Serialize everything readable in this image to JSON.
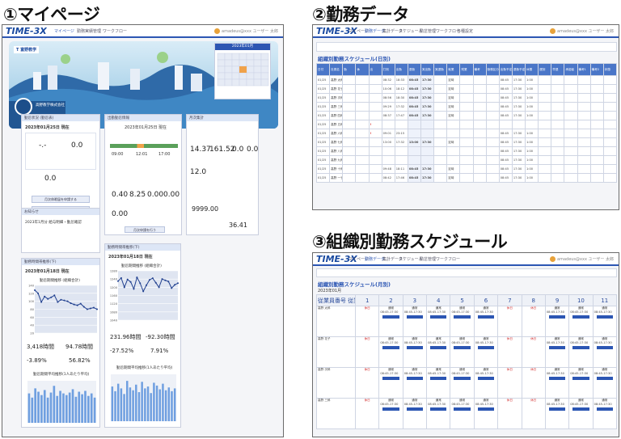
{
  "labels": {
    "panel1": "①マイページ",
    "panel2": "②勤務データ",
    "panel3": "③組織別勤務スケジュール"
  },
  "app": {
    "logo": "TIME-3X",
    "nav1": [
      "マイページ",
      "勤務実績管理",
      "ワークフロー"
    ],
    "nav2": [
      "マイページ",
      "勤務データ",
      "集計データ",
      "スケジュール",
      "勤怠管理",
      "ワークフロー",
      "各種設定",
      "従業員",
      "設定"
    ],
    "user": "amadeus@xxx ユーザー 太郎"
  },
  "mypage": {
    "banner_brand": "T 富野教学",
    "banner_greeting": "高野教学株式会社",
    "calendar_title": "2023年01月",
    "card_titles": [
      "勤怠状況 (勤怠表)",
      "出勤勤怠情報",
      "月次集計",
      "お知らせ",
      "勤務時間帯推移(下)",
      "勤務時間帯推移(下)"
    ],
    "clock_date": "2023年01月25日 現在",
    "work_times": [
      "09:00",
      "17:00",
      "12:01"
    ],
    "work_times_end": "17:00",
    "stats_top": [
      "14.37",
      "161.52",
      "0.0",
      "0.0"
    ],
    "stats_mid": [
      "12.0"
    ],
    "stats_detail": [
      "0.40",
      "8.25",
      "0.00",
      "0.00"
    ],
    "stats_zero": "0.00",
    "balance": [
      "9999.00",
      "36.41"
    ],
    "clock_buttons": [
      "月次休暇届を申請する",
      "月次休暇届を承認する"
    ],
    "detail_button": "月次申請を行う",
    "notice_title": "2023年1月分 給与明細・勤怠確認",
    "left_date": "2023年01月18日 現在",
    "right_date": "2023年01月18日 現在",
    "left_chart_title": "勤怠期間推移 (組織合計)",
    "right_chart_title": "勤怠期間推移 (組織合計)",
    "left_metrics": [
      "3,418時間",
      "94.78時間",
      "-3.89%",
      "56.82%"
    ],
    "right_metrics": [
      "231.96時間",
      "-92.30時間",
      "-27.52%",
      "7.91%"
    ],
    "left_bar_title": "勤怠期間平均推移(1人あたり平均)",
    "right_bar_title": "勤怠期間平均推移(1人あたり平均)"
  },
  "workdata": {
    "section_title": "組織別勤務スケジュール(日別)",
    "headers": [
      "日付",
      "社員名",
      "勤",
      "休",
      "出",
      "打刻",
      "出勤",
      "退勤",
      "実出勤",
      "実退勤",
      "就業",
      "残業",
      "備考",
      "勤務区分",
      "出勤予定",
      "退勤予定",
      "休憩",
      "遅刻",
      "早退",
      "承認者",
      "備考1",
      "備考2",
      "状態"
    ],
    "rows": [
      {
        "date": "01/25",
        "name": "高野 太郎",
        "t1": "08:32",
        "t2": "18:33",
        "in": "08:45",
        "out": "17:30",
        "kind": "定時",
        "plan_in": "08:45",
        "plan_out": "17:30",
        "rest": "1:00",
        "mark": ""
      },
      {
        "date": "01/25",
        "name": "高野 花子",
        "t1": "10:06",
        "t2": "18:12",
        "in": "08:45",
        "out": "17:30",
        "kind": "定時",
        "plan_in": "08:45",
        "plan_out": "17:30",
        "rest": "1:00",
        "mark": ""
      },
      {
        "date": "01/25",
        "name": "高野 次郎",
        "t1": "08:56",
        "t2": "18:30",
        "in": "08:45",
        "out": "17:30",
        "kind": "定時",
        "plan_in": "08:45",
        "plan_out": "17:30",
        "rest": "1:00",
        "mark": ""
      },
      {
        "date": "01/25",
        "name": "高野 三郎",
        "t1": "09:29",
        "t2": "17:32",
        "in": "08:45",
        "out": "17:30",
        "kind": "定時",
        "plan_in": "08:45",
        "plan_out": "17:30",
        "rest": "1:00",
        "mark": ""
      },
      {
        "date": "01/25",
        "name": "高野 四郎",
        "t1": "08:37",
        "t2": "17:47",
        "in": "08:45",
        "out": "17:30",
        "kind": "定時",
        "plan_in": "08:45",
        "plan_out": "17:30",
        "rest": "1:00",
        "mark": ""
      },
      {
        "date": "01/25",
        "name": "高野 五郎",
        "t1": "",
        "t2": "",
        "in": "",
        "out": "",
        "kind": "",
        "plan_in": "",
        "plan_out": "",
        "rest": "",
        "mark": "!"
      },
      {
        "date": "01/25",
        "name": "高野 六郎",
        "t1": "09:01",
        "t2": "23:15",
        "in": "",
        "out": "",
        "kind": "",
        "plan_in": "08:45",
        "plan_out": "17:30",
        "rest": "1:00",
        "mark": "!"
      },
      {
        "date": "01/25",
        "name": "高野 七郎",
        "t1": "13:00",
        "t2": "17:32",
        "in": "13:00",
        "out": "17:30",
        "kind": "定時",
        "plan_in": "08:45",
        "plan_out": "17:30",
        "rest": "1:00",
        "mark": ""
      },
      {
        "date": "01/25",
        "name": "高野 八郎",
        "t1": "",
        "t2": "",
        "in": "",
        "out": "",
        "kind": "",
        "plan_in": "08:45",
        "plan_out": "17:30",
        "rest": "1:00",
        "mark": ""
      },
      {
        "date": "01/25",
        "name": "高野 九郎",
        "t1": "",
        "t2": "",
        "in": "",
        "out": "",
        "kind": "",
        "plan_in": "08:45",
        "plan_out": "17:30",
        "rest": "1:00",
        "mark": ""
      },
      {
        "date": "01/25",
        "name": "高野 十郎",
        "t1": "09:48",
        "t2": "18:11",
        "in": "08:45",
        "out": "17:30",
        "kind": "定時",
        "plan_in": "08:45",
        "plan_out": "17:30",
        "rest": "1:00",
        "mark": ""
      },
      {
        "date": "01/25",
        "name": "高野 一子",
        "t1": "08:42",
        "t2": "17:46",
        "in": "08:45",
        "out": "17:30",
        "kind": "定時",
        "plan_in": "08:45",
        "plan_out": "17:30",
        "rest": "1:00",
        "mark": ""
      }
    ]
  },
  "schedule": {
    "section_title": "組織別勤務スケジュール(月別)",
    "month": "2023年01月",
    "corner": "従業員番号 従業員名 所属",
    "days": [
      "1",
      "2",
      "3",
      "4",
      "5",
      "6",
      "7",
      "8",
      "9",
      "10",
      "11"
    ],
    "people": [
      "高野 太郎",
      "高野 花子",
      "高野 次郎",
      "高野 三郎"
    ],
    "cell_main": "休日",
    "cell_work": "通常",
    "cell_time": "08:45-17:30"
  },
  "chart_data": [
    {
      "type": "line",
      "title": "勤怠期間推移 (組織合計)",
      "xlabel": "",
      "ylabel": "",
      "ylim": [
        20,
        140
      ],
      "yticks": [
        "140",
        "120",
        "100",
        "80",
        "60",
        "40",
        "20"
      ],
      "x": [
        "1",
        "2",
        "3",
        "4",
        "5",
        "6",
        "7",
        "8",
        "9",
        "10",
        "11",
        "12",
        "13",
        "14",
        "15",
        "16",
        "17",
        "18",
        "19",
        "20"
      ],
      "series": [
        {
          "name": "",
          "values": [
            128,
            120,
            98,
            112,
            106,
            110,
            115,
            98,
            104,
            102,
            100,
            95,
            92,
            90,
            94,
            86,
            80,
            82,
            84,
            80
          ]
        }
      ]
    },
    {
      "type": "line",
      "title": "勤怠期間推移 (組織合計)",
      "xlabel": "",
      "ylabel": "",
      "ylim": [
        1040,
        1280
      ],
      "yticks": [
        "1280",
        "1240",
        "1200",
        "1160",
        "1120",
        "1080",
        "1040"
      ],
      "x": [
        "1",
        "2",
        "3",
        "4",
        "5",
        "6",
        "7",
        "8",
        "9",
        "10",
        "11",
        "12",
        "13",
        "14",
        "15",
        "16",
        "17",
        "18",
        "19",
        "20"
      ],
      "series": [
        {
          "name": "",
          "values": [
            1230,
            1245,
            1200,
            1238,
            1226,
            1192,
            1248,
            1220,
            1180,
            1210,
            1236,
            1244,
            1222,
            1200,
            1240,
            1234,
            1228,
            1196,
            1212,
            1220
          ]
        }
      ]
    },
    {
      "type": "bar",
      "title": "勤怠期間平均推移(1人あたり平均)",
      "categories": [
        "1",
        "2",
        "3",
        "4",
        "5",
        "6",
        "7",
        "8",
        "9",
        "10",
        "11",
        "12",
        "13",
        "14",
        "15",
        "16",
        "17",
        "18",
        "19",
        "20",
        "21",
        "22"
      ],
      "values": [
        70,
        60,
        82,
        74,
        66,
        78,
        60,
        72,
        88,
        64,
        76,
        70,
        66,
        72,
        80,
        62,
        74,
        68,
        76,
        64,
        70,
        60
      ],
      "ylim": [
        0,
        100
      ]
    },
    {
      "type": "bar",
      "title": "勤怠期間平均推移(1人あたり平均)",
      "categories": [
        "1",
        "2",
        "3",
        "4",
        "5",
        "6",
        "7",
        "8",
        "9",
        "10",
        "11",
        "12",
        "13",
        "14",
        "15",
        "16",
        "17",
        "18",
        "19",
        "20",
        "21",
        "22"
      ],
      "values": [
        74,
        64,
        80,
        70,
        58,
        86,
        72,
        66,
        78,
        62,
        84,
        70,
        74,
        60,
        82,
        76,
        68,
        80,
        66,
        72,
        64,
        70
      ],
      "ylim": [
        0,
        100
      ]
    }
  ]
}
